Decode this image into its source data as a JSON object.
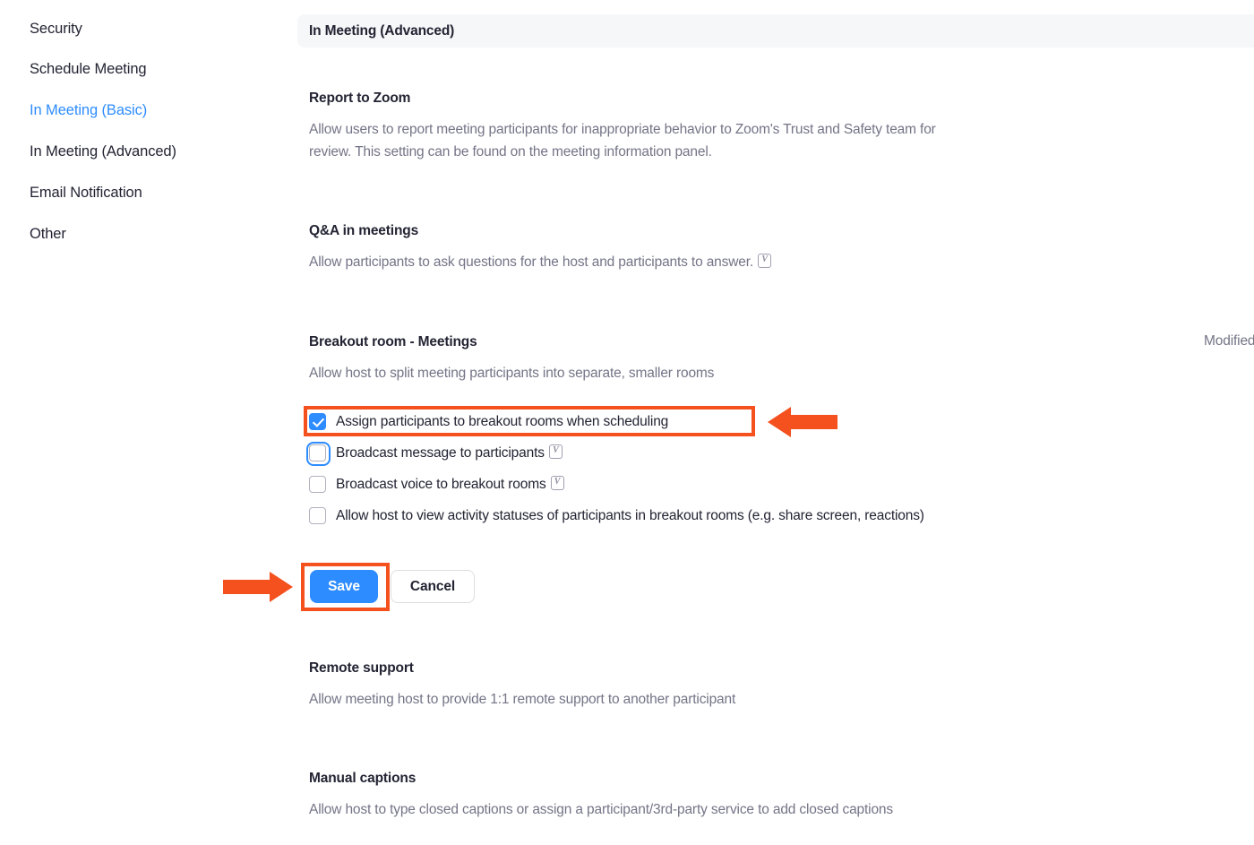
{
  "sidebar": {
    "items": [
      {
        "label": "Security",
        "active": false
      },
      {
        "label": "Schedule Meeting",
        "active": false
      },
      {
        "label": "In Meeting (Basic)",
        "active": true
      },
      {
        "label": "In Meeting (Advanced)",
        "active": false
      },
      {
        "label": "Email Notification",
        "active": false
      },
      {
        "label": "Other",
        "active": false
      }
    ]
  },
  "section": {
    "header_title": "In Meeting (Advanced)"
  },
  "settings": {
    "report_to_zoom": {
      "title": "Report to Zoom",
      "desc": "Allow users to report meeting participants for inappropriate behavior to Zoom's Trust and Safety team for review. This setting can be found on the meeting information panel.",
      "toggle_state": "on"
    },
    "qa_in_meetings": {
      "title": "Q&A in meetings",
      "desc": "Allow participants to ask questions for the host and participants to answer.",
      "toggle_state": "off",
      "has_video_icon": true
    },
    "breakout_room": {
      "title": "Breakout room - Meetings",
      "desc": "Allow host to split meeting participants into separate, smaller rooms",
      "toggle_state": "on",
      "status_label": "Modified",
      "options": [
        {
          "label": "Assign participants to breakout rooms when scheduling",
          "checked": true,
          "focused": false,
          "video_icon": false
        },
        {
          "label": "Broadcast message to participants",
          "checked": false,
          "focused": true,
          "video_icon": true
        },
        {
          "label": "Broadcast voice to breakout rooms",
          "checked": false,
          "focused": false,
          "video_icon": true
        },
        {
          "label": "Allow host to view activity statuses of participants in breakout rooms (e.g. share screen, reactions)",
          "checked": false,
          "focused": false,
          "video_icon": false
        }
      ],
      "save_label": "Save",
      "cancel_label": "Cancel"
    },
    "remote_support": {
      "title": "Remote support",
      "desc": "Allow meeting host to provide 1:1 remote support to another participant",
      "toggle_state": "off"
    },
    "manual_captions": {
      "title": "Manual captions",
      "desc": "Allow host to type closed captions or assign a participant/3rd-party service to add closed captions",
      "toggle_state": "off"
    }
  },
  "colors": {
    "accent_blue": "#2d8cff",
    "annotation_orange": "#f4511e",
    "toggle_off_gray": "#5a5a6e",
    "heading_text": "#232333",
    "body_text": "#747487",
    "header_bg": "#f6f7f9"
  }
}
